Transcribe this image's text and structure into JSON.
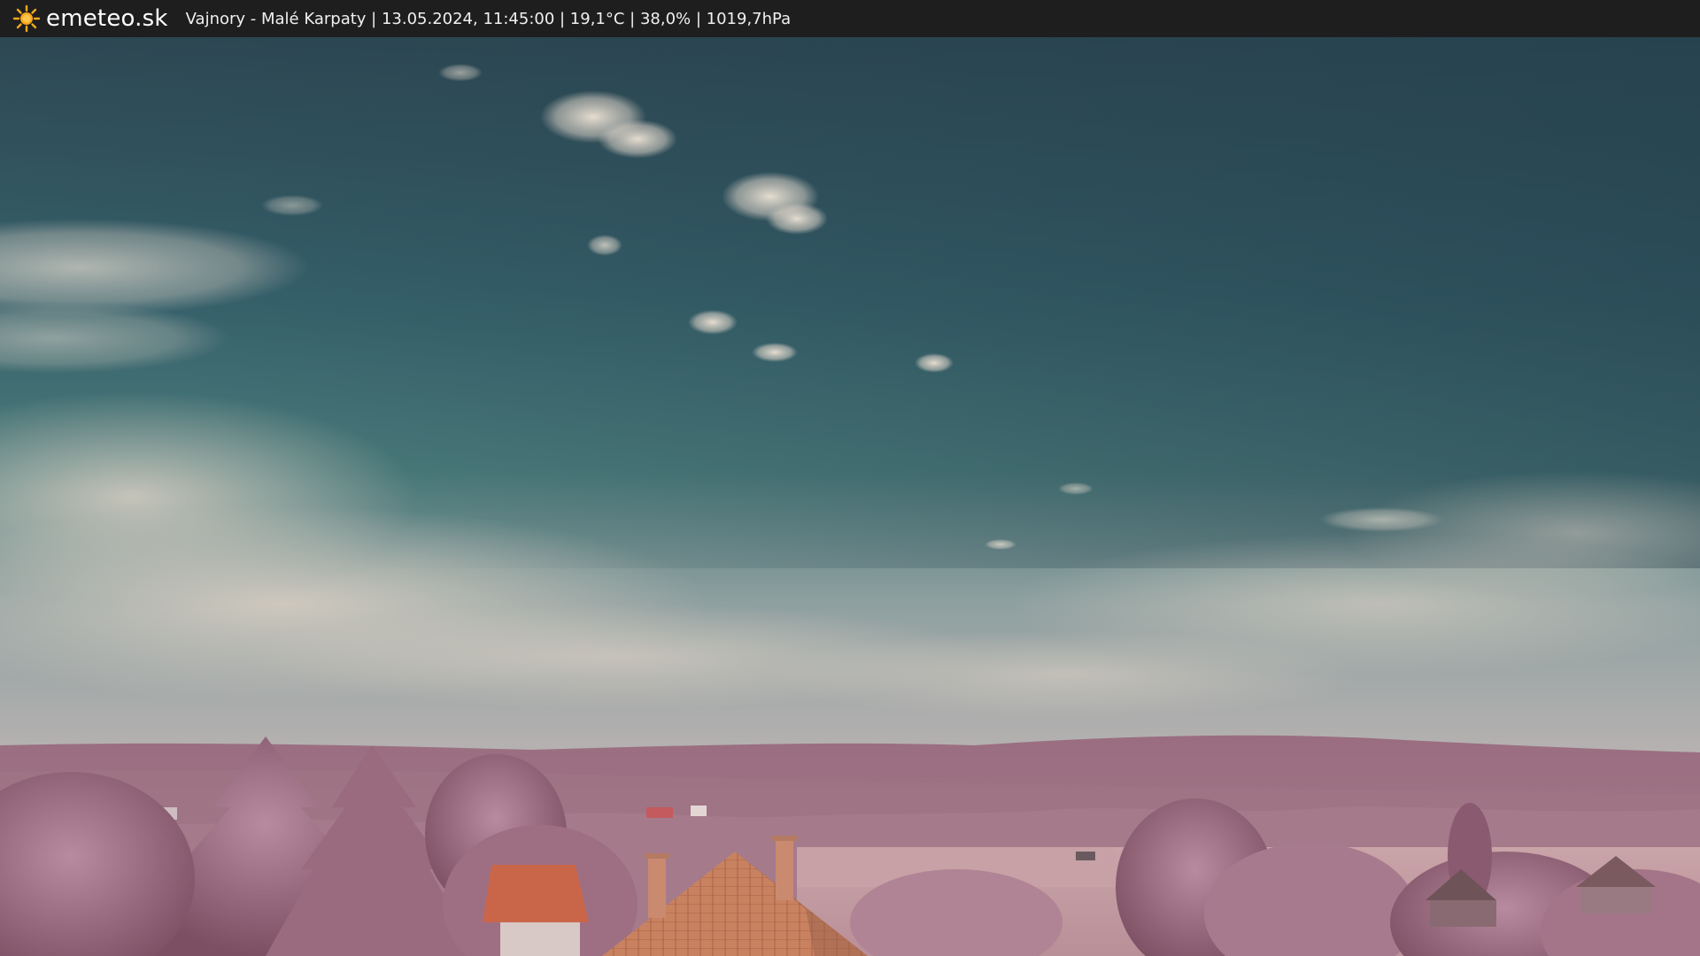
{
  "header": {
    "brand": "emeteo.sk",
    "status_line": "Vajnory - Malé Karpaty | 13.05.2024, 11:45:00 | 19,1°C | 38,0% | 1019,7hPa",
    "logo_icon": "sun-icon"
  },
  "colors": {
    "bar_background": "#1e1e1e",
    "sun": "#f7a81b",
    "sky_top": "#2f4a55",
    "sky_mid": "#3b6f74",
    "hills": "#9c6f80",
    "trees": "#a8768a",
    "roof": "#c46a4a"
  }
}
